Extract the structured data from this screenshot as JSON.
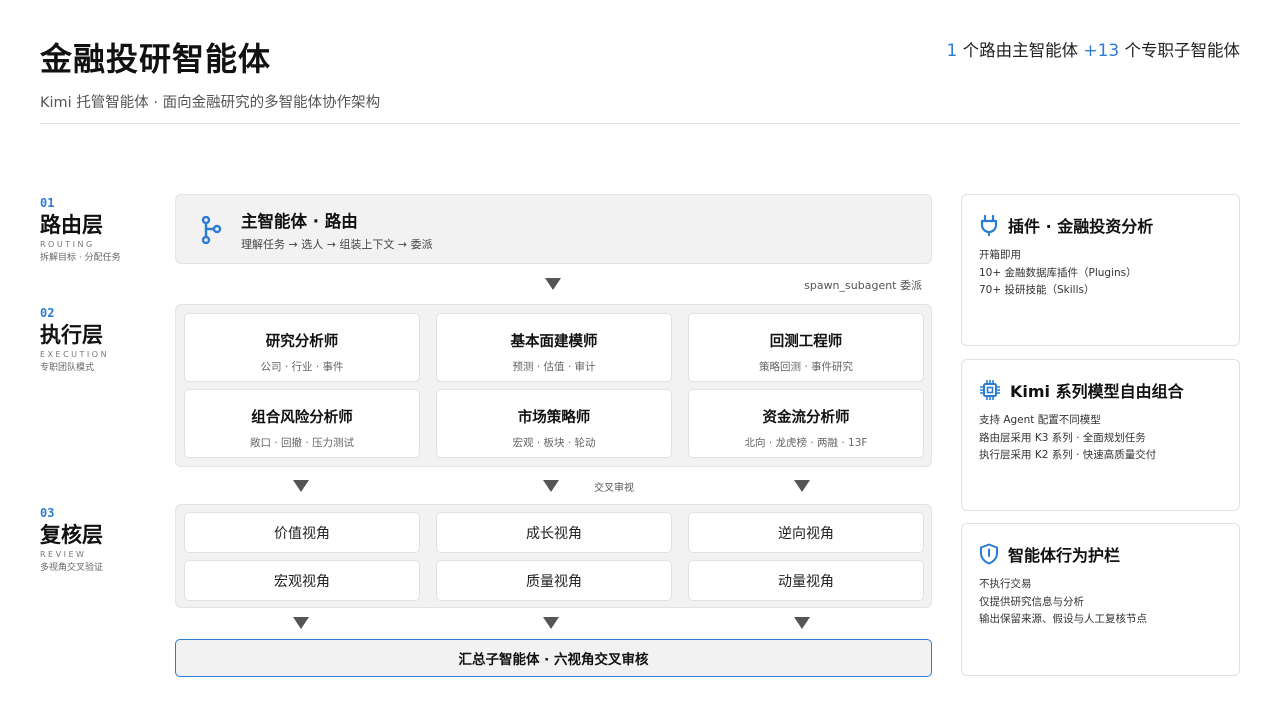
{
  "header": {
    "title": "金融投研智能体",
    "subtitle": "Kimi 托管智能体 · 面向金融研究的多智能体协作架构",
    "stats_num1": "1",
    "stats_text1": " 个路由主智能体 ",
    "stats_num2": "+13",
    "stats_text2": " 个专职子智能体"
  },
  "layers": [
    {
      "num": "01",
      "name": "路由层",
      "en": "ROUTING",
      "desc": "拆解目标 · 分配任务"
    },
    {
      "num": "02",
      "name": "执行层",
      "en": "EXECUTION",
      "desc": "专职团队模式"
    },
    {
      "num": "03",
      "name": "复核层",
      "en": "REVIEW",
      "desc": "多视角交叉验证"
    }
  ],
  "routing": {
    "title": "主智能体 · 路由",
    "desc": "理解任务 → 选人 → 组装上下文 → 委派",
    "icon": "branch-icon",
    "spawn_note": "spawn_subagent 委派"
  },
  "execution": {
    "agents": [
      {
        "title": "研究分析师",
        "desc": "公司 · 行业 · 事件"
      },
      {
        "title": "基本面建模师",
        "desc": "预测 · 估值 · 审计"
      },
      {
        "title": "回测工程师",
        "desc": "策略回测 · 事件研究"
      },
      {
        "title": "组合风险分析师",
        "desc": "敞口 · 回撤 · 压力测试"
      },
      {
        "title": "市场策略师",
        "desc": "宏观 · 板块 · 轮动"
      },
      {
        "title": "资金流分析师",
        "desc": "北向 · 龙虎榜 · 两融 · 13F"
      }
    ],
    "cross_note": "交叉审视"
  },
  "review": {
    "perspectives": [
      "价值视角",
      "成长视角",
      "逆向视角",
      "宏观视角",
      "质量视角",
      "动量视角"
    ],
    "summary": "汇总子智能体 · 六视角交叉审核"
  },
  "side_panels": [
    {
      "icon": "plug-icon",
      "title": "插件 · 金融投资分析",
      "lines": [
        "开箱即用",
        "10+ 金融数据库插件（Plugins）",
        "70+ 投研技能（Skills）"
      ]
    },
    {
      "icon": "chip-icon",
      "title": "Kimi 系列模型自由组合",
      "lines": [
        "支持 Agent 配置不同模型",
        "路由层采用 K3 系列 · 全面规划任务",
        "执行层采用 K2 系列 · 快速高质量交付"
      ]
    },
    {
      "icon": "shield-icon",
      "title": "智能体行为护栏",
      "lines": [
        "不执行交易",
        "仅提供研究信息与分析",
        "输出保留来源、假设与人工复核节点"
      ]
    }
  ],
  "colors": {
    "accent": "#2b7cd3",
    "panel": "#f2f2f2",
    "arrow": "#555555"
  }
}
